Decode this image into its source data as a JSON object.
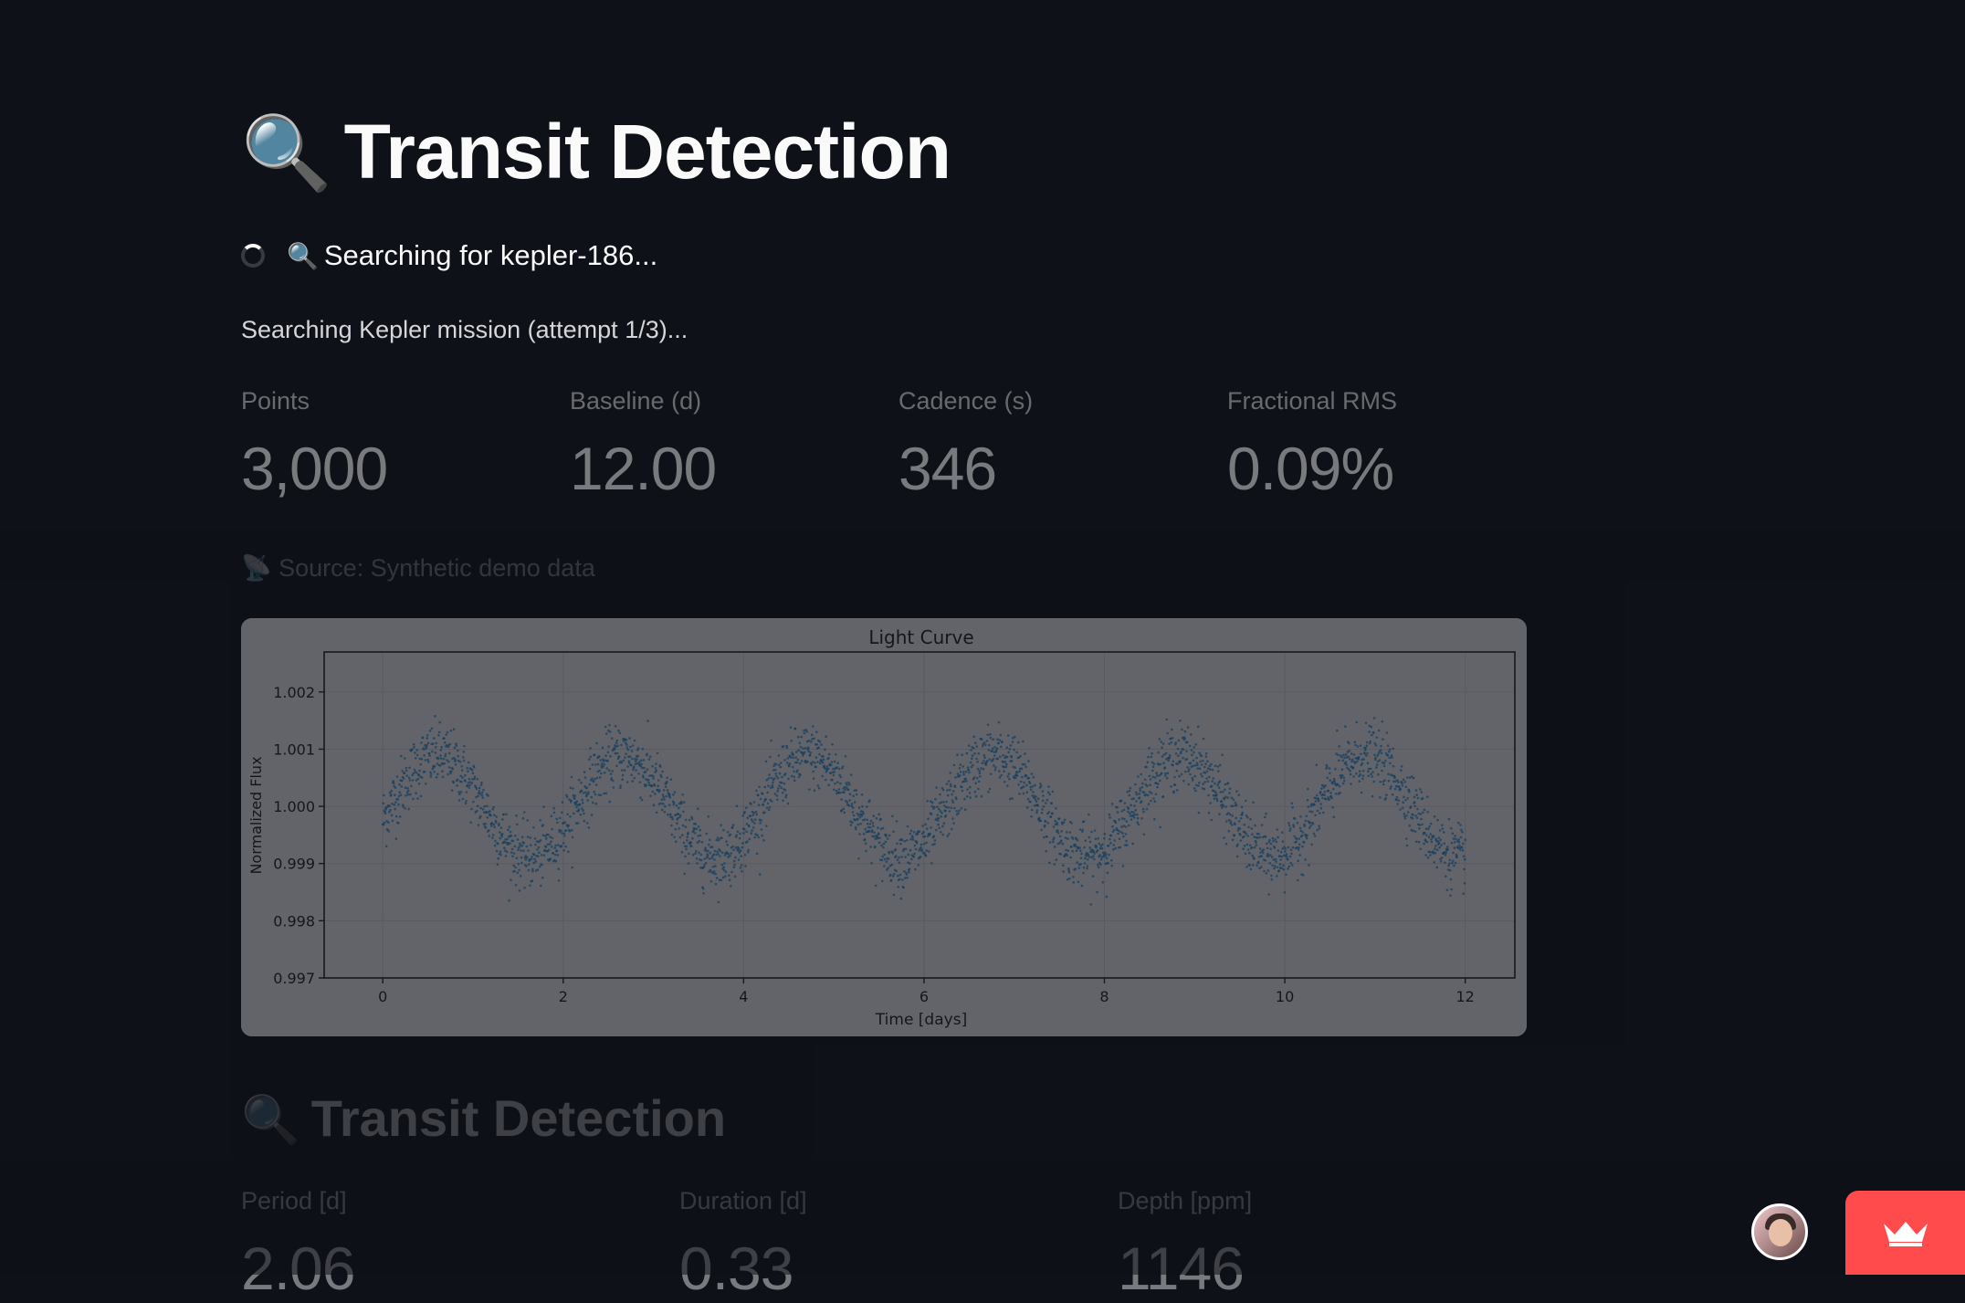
{
  "header": {
    "title": "Transit Detection",
    "title_emoji": "🔍"
  },
  "spinner": {
    "emoji": "🔍",
    "text": "Searching for kepler-186..."
  },
  "status": "Searching Kepler mission (attempt 1/3)...",
  "metrics": [
    {
      "label": "Points",
      "value": "3,000"
    },
    {
      "label": "Baseline (d)",
      "value": "12.00"
    },
    {
      "label": "Cadence (s)",
      "value": "346"
    },
    {
      "label": "Fractional RMS",
      "value": "0.09%"
    }
  ],
  "source": {
    "emoji": "📡",
    "text": "Source: Synthetic demo data"
  },
  "chart_data": {
    "type": "scatter",
    "title": "Light Curve",
    "xlabel": "Time [days]",
    "ylabel": "Normalized Flux",
    "xlim": [
      -0.65,
      12.55
    ],
    "ylim": [
      0.997,
      1.0027
    ],
    "xticks": [
      0,
      2,
      4,
      6,
      8,
      10,
      12
    ],
    "yticks": [
      0.997,
      0.998,
      0.999,
      1.0,
      1.001,
      1.002
    ],
    "ytick_labels": [
      "0.997",
      "0.998",
      "0.999",
      "1.000",
      "1.001",
      "1.002"
    ],
    "grid": true,
    "point_color": "#1f77b4",
    "series": [
      {
        "n_points": 3000,
        "x_range": [
          0,
          12
        ],
        "signal": "sinusoid",
        "mean": 1.0,
        "amplitude": 0.00088,
        "period_days": 2.06,
        "peak_time_days": 0.6,
        "scatter_std": 0.00028
      }
    ]
  },
  "section": {
    "title": "Transit Detection",
    "emoji": "🔍"
  },
  "results": [
    {
      "label": "Period [d]",
      "value": "2.06"
    },
    {
      "label": "Duration [d]",
      "value": "0.33"
    },
    {
      "label": "Depth [ppm]",
      "value": "1146"
    }
  ],
  "colors": {
    "background": "#0e1117",
    "text": "#fafafa",
    "brand": "#ff4b4b",
    "chart_bg": "#c9c9cf"
  }
}
